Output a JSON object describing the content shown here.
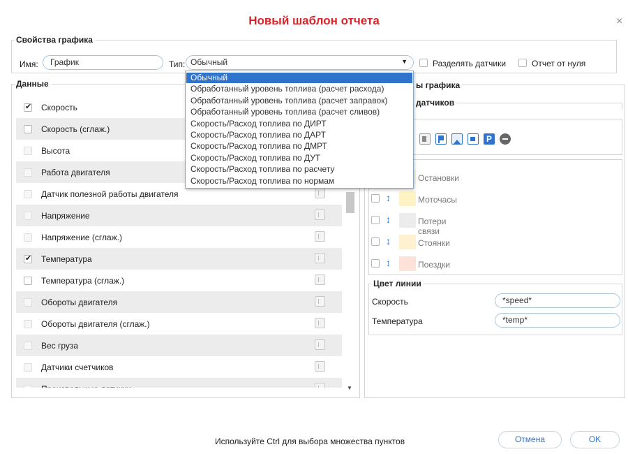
{
  "dialog": {
    "title": "Новый шаблон отчета",
    "close": "×"
  },
  "props": {
    "legend": "Свойства графика",
    "name_label": "Имя:",
    "name_value": "График",
    "type_label": "Тип:",
    "type_value": "Обычный",
    "split_sensors": "Разделять датчики",
    "from_zero": "Отчет от нуля"
  },
  "type_options": [
    "Обычный",
    "Обработанный уровень топлива (расчет расхода)",
    "Обработанный уровень топлива (расчет заправок)",
    "Обработанный уровень топлива (расчет сливов)",
    "Скорость/Расход топлива по ДИРТ",
    "Скорость/Расход топлива по ДАРТ",
    "Скорость/Расход топлива по ДМРТ",
    "Скорость/Расход топлива по ДУТ",
    "Скорость/Расход топлива по расчету",
    "Скорость/Расход топлива по нормам"
  ],
  "data": {
    "legend": "Данные",
    "items": [
      {
        "label": "Скорость",
        "checked": true,
        "disabled": false
      },
      {
        "label": "Скорость (сглаж.)",
        "checked": false,
        "disabled": false
      },
      {
        "label": "Высота",
        "checked": false,
        "disabled": true
      },
      {
        "label": "Работа двигателя",
        "checked": false,
        "disabled": true
      },
      {
        "label": "Датчик полезной работы двигателя",
        "checked": false,
        "disabled": true
      },
      {
        "label": "Напряжение",
        "checked": false,
        "disabled": true
      },
      {
        "label": "Напряжение (сглаж.)",
        "checked": false,
        "disabled": true
      },
      {
        "label": "Температура",
        "checked": true,
        "disabled": false
      },
      {
        "label": "Температура (сглаж.)",
        "checked": false,
        "disabled": false
      },
      {
        "label": "Обороты двигателя",
        "checked": false,
        "disabled": true
      },
      {
        "label": "Обороты двигателя (сглаж.)",
        "checked": false,
        "disabled": true
      },
      {
        "label": "Вес груза",
        "checked": false,
        "disabled": true
      },
      {
        "label": "Датчики счетчиков",
        "checked": false,
        "disabled": true
      },
      {
        "label": "Произвольные датчики",
        "checked": false,
        "disabled": true
      }
    ]
  },
  "right": {
    "legend_partial": "ы графика",
    "sensors_partial": "датчиков",
    "events": [
      {
        "label": "Остановки",
        "color": "#fdf6d8"
      },
      {
        "label": "Моточасы",
        "color": "#fdf3c4"
      },
      {
        "label": "Потери связи",
        "color": "#ececec"
      },
      {
        "label": "Стоянки",
        "color": "#fdf1d2"
      },
      {
        "label": "Поездки",
        "color": "#fde2da"
      }
    ],
    "line_color": {
      "legend": "Цвет линии",
      "rows": [
        {
          "label": "Скорость",
          "value": "*speed*"
        },
        {
          "label": "Температура",
          "value": "*temp*"
        }
      ]
    },
    "toolbar_icons": [
      "fuel-icon",
      "flag-icon",
      "image-icon",
      "video-icon",
      "parking-icon",
      "minus-circle-icon"
    ]
  },
  "footer": {
    "hint": "Используйте Ctrl для выбора множества пунктов",
    "cancel": "Отмена",
    "ok": "OK"
  }
}
